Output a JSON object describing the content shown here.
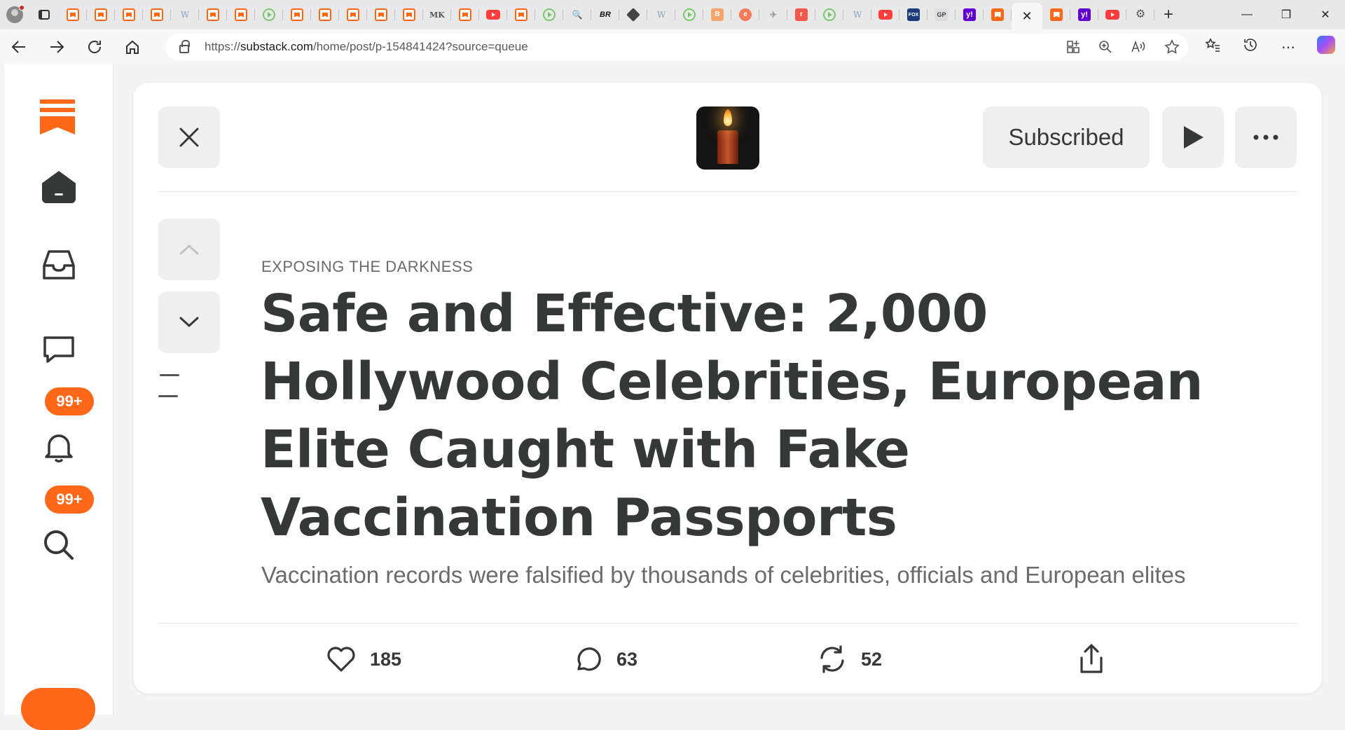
{
  "browser": {
    "url_prefix": "https://",
    "url_domain": "substack.com",
    "url_path": "/home/post/p-154841424?source=queue",
    "window_controls": {
      "minimize": "—",
      "maximize": "❐",
      "close": "✕"
    },
    "tab_favicons": [
      {
        "kind": "ss",
        "text": ""
      },
      {
        "kind": "ss",
        "text": ""
      },
      {
        "kind": "ss",
        "text": ""
      },
      {
        "kind": "ss",
        "text": ""
      },
      {
        "kind": "wiki",
        "text": "W"
      },
      {
        "kind": "ss",
        "text": ""
      },
      {
        "kind": "ss",
        "text": ""
      },
      {
        "kind": "play",
        "text": ""
      },
      {
        "kind": "ss",
        "text": ""
      },
      {
        "kind": "ss",
        "text": ""
      },
      {
        "kind": "ss",
        "text": ""
      },
      {
        "kind": "ss",
        "text": ""
      },
      {
        "kind": "ss",
        "text": ""
      },
      {
        "kind": "mk",
        "text": "MK"
      },
      {
        "kind": "ss",
        "text": ""
      },
      {
        "kind": "yt",
        "text": ""
      },
      {
        "kind": "ss",
        "text": ""
      },
      {
        "kind": "play",
        "text": ""
      },
      {
        "kind": "search",
        "text": "🔍"
      },
      {
        "kind": "br",
        "text": "BR"
      },
      {
        "kind": "diamond",
        "text": ""
      },
      {
        "kind": "wiki",
        "text": "W"
      },
      {
        "kind": "play",
        "text": ""
      },
      {
        "kind": "bb",
        "text": "B"
      },
      {
        "kind": "ee",
        "text": "e"
      },
      {
        "kind": "bird",
        "text": "✈"
      },
      {
        "kind": "rr",
        "text": "r"
      },
      {
        "kind": "play",
        "text": ""
      },
      {
        "kind": "wiki",
        "text": "W"
      },
      {
        "kind": "yt",
        "text": ""
      },
      {
        "kind": "fox",
        "text": "FOX"
      },
      {
        "kind": "gp",
        "text": "GP"
      },
      {
        "kind": "yahoo",
        "text": "y!"
      },
      {
        "kind": "ssfull",
        "text": ""
      }
    ],
    "active_tab_close": "✕",
    "tabs_after_active": [
      {
        "kind": "ssfull",
        "text": ""
      },
      {
        "kind": "yahoo",
        "text": "y!"
      },
      {
        "kind": "yt",
        "text": ""
      },
      {
        "kind": "gear",
        "text": "⚙"
      }
    ],
    "new_tab": "+"
  },
  "nav": {
    "messages_badge": "99+",
    "notifications_badge": "99+"
  },
  "post": {
    "subscribe_label": "Subscribed",
    "publication": "EXPOSING THE DARKNESS",
    "title": "Safe and Effective: 2,000 Hollywood Celebrities, European Elite Caught with Fake Vaccination Passports",
    "subtitle": "Vaccination records were falsified by thousands of celebrities, officials and European elites",
    "likes": "185",
    "comments": "63",
    "restacks": "52"
  },
  "colors": {
    "accent": "#ff6719",
    "text": "#363737",
    "muted": "#6b6b6b"
  }
}
